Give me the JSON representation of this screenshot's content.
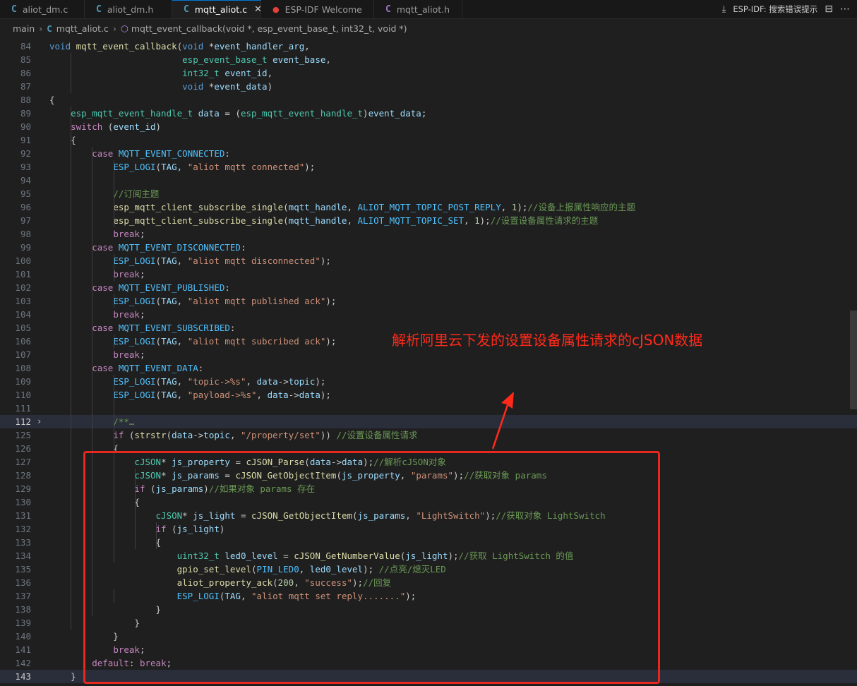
{
  "tabs": [
    {
      "label": "aliot_dm.c",
      "icon": "c-file-icon",
      "active": false
    },
    {
      "label": "aliot_dm.h",
      "icon": "c-file-icon",
      "active": false
    },
    {
      "label": "mqtt_aliot.c",
      "icon": "c-file-icon",
      "active": true
    },
    {
      "label": "ESP-IDF Welcome",
      "icon": "espressif-icon",
      "active": false
    },
    {
      "label": "mqtt_aliot.h",
      "icon": "c-header-icon",
      "active": false
    }
  ],
  "toolbar": {
    "esp_idf_label": "ESP-IDF: 搜索错误提示"
  },
  "breadcrumb": {
    "folder": "main",
    "file": "mqtt_aliot.c",
    "symbol": "mqtt_event_callback(void *, esp_event_base_t, int32_t, void *)"
  },
  "annotation": "解析阿里云下发的设置设备属性请求的cJSON数据",
  "code": {
    "current_line": "143",
    "lines": [
      {
        "n": "84",
        "t": "void mqtt_event_callback(void *event_handler_arg,"
      },
      {
        "n": "85",
        "t": "                         esp_event_base_t event_base,"
      },
      {
        "n": "86",
        "t": "                         int32_t event_id,"
      },
      {
        "n": "87",
        "t": "                         void *event_data)"
      },
      {
        "n": "88",
        "t": "{"
      },
      {
        "n": "89",
        "t": "    esp_mqtt_event_handle_t data = (esp_mqtt_event_handle_t)event_data;"
      },
      {
        "n": "90",
        "t": "    switch (event_id)"
      },
      {
        "n": "91",
        "t": "    {"
      },
      {
        "n": "92",
        "t": "        case MQTT_EVENT_CONNECTED:"
      },
      {
        "n": "93",
        "t": "            ESP_LOGI(TAG, \"aliot mqtt connected\");"
      },
      {
        "n": "94",
        "t": ""
      },
      {
        "n": "95",
        "t": "            //订阅主题"
      },
      {
        "n": "96",
        "t": "            esp_mqtt_client_subscribe_single(mqtt_handle, ALIOT_MQTT_TOPIC_POST_REPLY, 1);//设备上报属性响应的主题"
      },
      {
        "n": "97",
        "t": "            esp_mqtt_client_subscribe_single(mqtt_handle, ALIOT_MQTT_TOPIC_SET, 1);//设置设备属性请求的主题"
      },
      {
        "n": "98",
        "t": "            break;"
      },
      {
        "n": "99",
        "t": "        case MQTT_EVENT_DISCONNECTED:"
      },
      {
        "n": "100",
        "t": "            ESP_LOGI(TAG, \"aliot mqtt disconnected\");"
      },
      {
        "n": "101",
        "t": "            break;"
      },
      {
        "n": "102",
        "t": "        case MQTT_EVENT_PUBLISHED:"
      },
      {
        "n": "103",
        "t": "            ESP_LOGI(TAG, \"aliot mqtt published ack\");"
      },
      {
        "n": "104",
        "t": "            break;"
      },
      {
        "n": "105",
        "t": "        case MQTT_EVENT_SUBSCRIBED:"
      },
      {
        "n": "106",
        "t": "            ESP_LOGI(TAG, \"aliot mqtt subcribed ack\");"
      },
      {
        "n": "107",
        "t": "            break;"
      },
      {
        "n": "108",
        "t": "        case MQTT_EVENT_DATA:"
      },
      {
        "n": "109",
        "t": "            ESP_LOGI(TAG, \"topic->%s\", data->topic);"
      },
      {
        "n": "110",
        "t": "            ESP_LOGI(TAG, \"payload->%s\", data->data);"
      },
      {
        "n": "111",
        "t": ""
      },
      {
        "n": "112",
        "t": "            /**…"
      },
      {
        "n": "125",
        "t": "            if (strstr(data->topic, \"/property/set\")) //设置设备属性请求"
      },
      {
        "n": "126",
        "t": "            {"
      },
      {
        "n": "127",
        "t": "                cJSON* js_property = cJSON_Parse(data->data);//解析cJSON对象"
      },
      {
        "n": "128",
        "t": "                cJSON* js_params = cJSON_GetObjectItem(js_property, \"params\");//获取对象 params"
      },
      {
        "n": "129",
        "t": "                if (js_params)//如果对象 params 存在"
      },
      {
        "n": "130",
        "t": "                {"
      },
      {
        "n": "131",
        "t": "                    cJSON* js_light = cJSON_GetObjectItem(js_params, \"LightSwitch\");//获取对象 LightSwitch"
      },
      {
        "n": "132",
        "t": "                    if (js_light)"
      },
      {
        "n": "133",
        "t": "                    {"
      },
      {
        "n": "134",
        "t": "                        uint32_t led0_level = cJSON_GetNumberValue(js_light);//获取 LightSwitch 的值"
      },
      {
        "n": "135",
        "t": "                        gpio_set_level(PIN_LED0, led0_level); //点亮/熄灭LED"
      },
      {
        "n": "136",
        "t": "                        aliot_property_ack(200, \"success\");//回复"
      },
      {
        "n": "137",
        "t": "                        ESP_LOGI(TAG, \"aliot mqtt set reply.......\");"
      },
      {
        "n": "138",
        "t": "                    }"
      },
      {
        "n": "139",
        "t": "                }"
      },
      {
        "n": "140",
        "t": "            }"
      },
      {
        "n": "141",
        "t": "            break;"
      },
      {
        "n": "142",
        "t": "        default: break;"
      },
      {
        "n": "143",
        "t": "    }"
      }
    ]
  }
}
